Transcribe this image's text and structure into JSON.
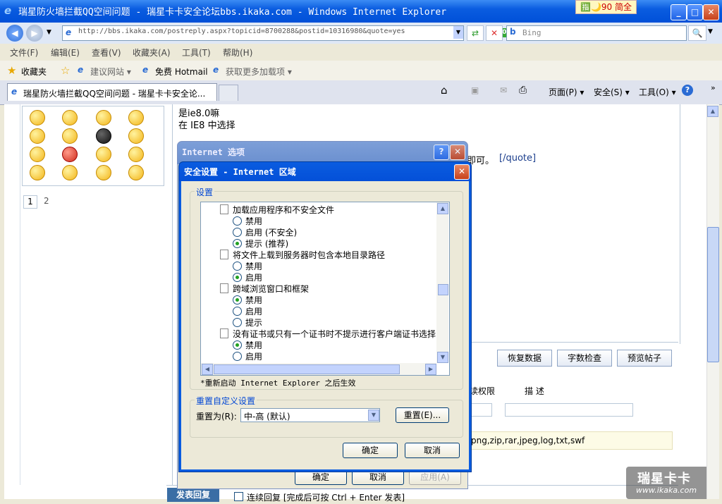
{
  "window": {
    "title": "瑞星防火墙拦截QQ空间问题 - 瑞星卡卡安全论坛bbs.ikaka.com - Windows Internet Explorer",
    "app_tag": "🈯🌙90 简全"
  },
  "address": {
    "url": "http://bbs.ikaka.com/postreply.aspx?topicid=8700288&postid=10316980&quote=yes",
    "badge": "360",
    "search_placeholder": "Bing"
  },
  "menu": [
    "文件(F)",
    "编辑(E)",
    "查看(V)",
    "收藏夹(A)",
    "工具(T)",
    "帮助(H)"
  ],
  "favorites": {
    "label": "收藏夹",
    "items": [
      "建议网站 ▾",
      "免费 Hotmail",
      "获取更多加载项 ▾"
    ]
  },
  "tab": {
    "label": "瑞星防火墙拦截QQ空间问题 - 瑞星卡卡安全论..."
  },
  "commands": [
    "页面(P) ▾",
    "安全(S) ▾",
    "工具(O) ▾"
  ],
  "page": {
    "pagination": [
      "1",
      "2"
    ],
    "post_lines": [
      "是ie8.0嘛",
      "在  IE8 中选择"
    ],
    "quote_tail": "即可。",
    "quote_tag": "[/quote]",
    "buttons": [
      "恢复数据",
      "字数检查",
      "预览帖子"
    ],
    "col_perm": "读权限",
    "col_desc": "描  述",
    "file_types": "png,zip,rar,jpeg,log,txt,swf",
    "reply_button": "发表回复",
    "continue_label": "连续回复 [完成后可按 Ctrl + Enter 发表]",
    "watermark_title": "瑞星卡卡",
    "watermark_url": "www.ikaka.com"
  },
  "options_dialog": {
    "title": "Internet 选项",
    "ok": "确定",
    "cancel": "取消",
    "apply": "应用(A)"
  },
  "security_dialog": {
    "title": "安全设置 - Internet 区域",
    "settings_group": "设置",
    "items": [
      {
        "type": "header",
        "text": "加载应用程序和不安全文件"
      },
      {
        "type": "radio",
        "text": "禁用",
        "checked": false
      },
      {
        "type": "radio",
        "text": "启用 (不安全)",
        "checked": false
      },
      {
        "type": "radio",
        "text": "提示 (推荐)",
        "checked": true
      },
      {
        "type": "header",
        "text": "将文件上载到服务器时包含本地目录路径"
      },
      {
        "type": "radio",
        "text": "禁用",
        "checked": false
      },
      {
        "type": "radio",
        "text": "启用",
        "checked": true
      },
      {
        "type": "header",
        "text": "跨域浏览窗口和框架"
      },
      {
        "type": "radio",
        "text": "禁用",
        "checked": true
      },
      {
        "type": "radio",
        "text": "启用",
        "checked": false
      },
      {
        "type": "radio",
        "text": "提示",
        "checked": false
      },
      {
        "type": "header",
        "text": "没有证书或只有一个证书时不提示进行客户端证书选择"
      },
      {
        "type": "radio",
        "text": "禁用",
        "checked": true
      },
      {
        "type": "radio",
        "text": "启用",
        "checked": false
      }
    ],
    "restart_note": "*重新启动 Internet Explorer 之后生效",
    "reset_group": "重置自定义设置",
    "reset_to_label": "重置为(R):",
    "reset_value": "中-高 (默认)",
    "reset_button": "重置(E)...",
    "ok": "确定",
    "cancel": "取消"
  }
}
